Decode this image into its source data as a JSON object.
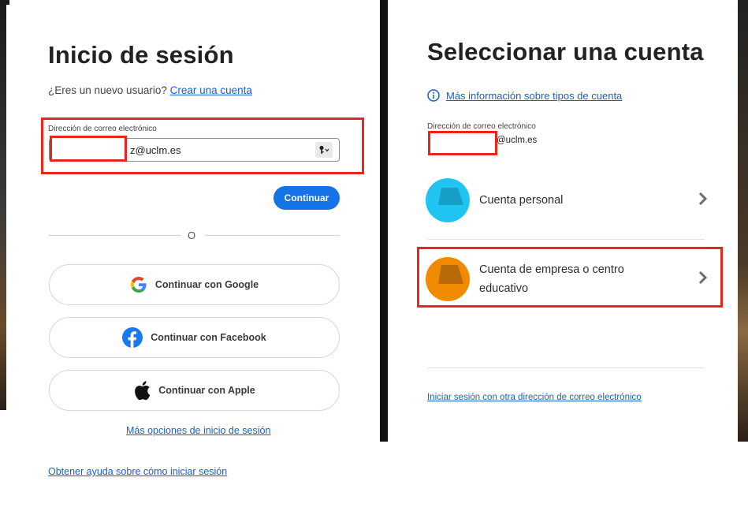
{
  "left": {
    "title": "Inicio de sesión",
    "new_user_prompt": "¿Eres un nuevo usuario?",
    "create_account_link": "Crear una cuenta",
    "email_label": "Dirección de correo electrónico",
    "email_value": "z@uclm.es",
    "continue_button": "Continuar",
    "or_separator": "O",
    "google_button": "Continuar con Google",
    "facebook_button": "Continuar con Facebook",
    "apple_button": "Continuar con Apple",
    "more_options_link": "Más opciones de inicio de sesión",
    "help_link": "Obtener ayuda sobre cómo iniciar sesión"
  },
  "right": {
    "title": "Seleccionar una cuenta",
    "info_link": "Más información sobre tipos de cuenta",
    "email_label": "Dirección de correo electrónico",
    "email_value": "@uclm.es",
    "personal_account": "Cuenta personal",
    "business_account_line1": "Cuenta de empresa o centro",
    "business_account_line2": "educativo",
    "other_email_link": "Iniciar sesión con otra dirección de correo electrónico"
  },
  "colors": {
    "accent": "#1473e6",
    "highlight": "#e8261b",
    "personal_avatar": "#20c4f0",
    "business_avatar": "#f08a00"
  },
  "icons": [
    "key-icon",
    "google-icon",
    "facebook-icon",
    "apple-icon",
    "info-icon",
    "chevron-right-icon"
  ]
}
